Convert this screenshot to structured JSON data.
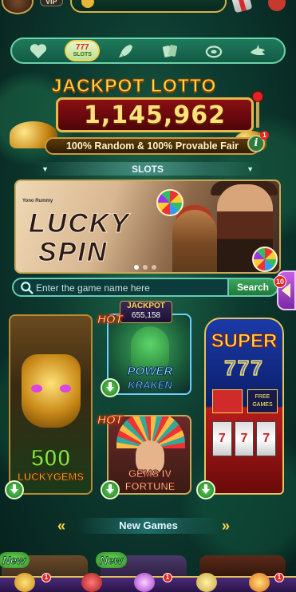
{
  "topbar": {
    "vip_label": "VIP"
  },
  "categories": [
    {
      "name": "favorites",
      "icon": "heart-icon"
    },
    {
      "name": "slots",
      "icon": "slots-777-icon",
      "label_top": "777",
      "label_bottom": "SLOTS",
      "active": true
    },
    {
      "name": "rocket",
      "icon": "rocket-icon"
    },
    {
      "name": "cards",
      "icon": "cards-icon"
    },
    {
      "name": "roulette",
      "icon": "roulette-icon"
    },
    {
      "name": "fishing",
      "icon": "shark-icon"
    }
  ],
  "jackpot": {
    "title": "JACKPOT LOTTO",
    "amount": "1,145,962",
    "subtitle": "100% Random & 100% Provable Fair",
    "info_badge": "1"
  },
  "section": {
    "title": "SLOTS"
  },
  "banner": {
    "brand": "Yono Rummy",
    "title_line1": "LUCKY",
    "title_line2": "SPIN",
    "dots_total": 3,
    "dots_active": 0
  },
  "search": {
    "placeholder": "Enter the game name here",
    "button": "Search",
    "side_badge": "10"
  },
  "games": {
    "lucky_gems": {
      "title_top": "500",
      "title_bottom": "LUCKYGEMS"
    },
    "kraken": {
      "hot": "HOT",
      "jackpot_label": "JACKPOT",
      "jackpot_value": "655,158",
      "title_top": "POWER",
      "title_bottom": "KRAKEN"
    },
    "gems_fortune": {
      "hot": "HOT",
      "title_top": "GEMS IV",
      "title_bottom": "FORTUNE"
    },
    "super_777": {
      "title_top": "SUPER",
      "title_bottom": "777",
      "free_games": "FREE GAMES",
      "reel_symbol": "7"
    }
  },
  "new_games": {
    "title": "New Games",
    "new_tag": "New"
  },
  "bottom_nav": {
    "badge_1": "1",
    "badge_2": "1",
    "badge_3": "1"
  },
  "colors": {
    "accent_gold": "#ffd646",
    "brand_green": "#1f7a5c",
    "jackpot_red": "#8a0f12"
  }
}
